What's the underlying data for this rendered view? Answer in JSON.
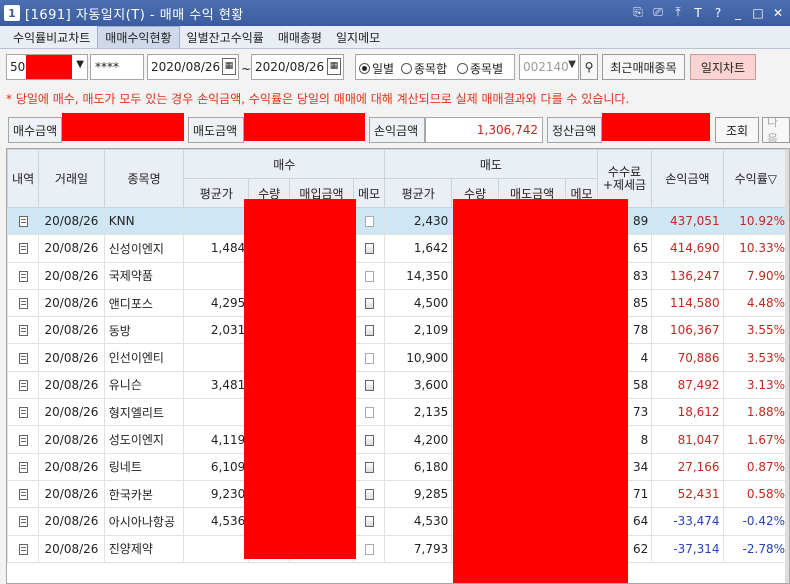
{
  "window": {
    "number": "1",
    "title": "[1691] 자동일지(T) - 매매 수익 현황",
    "controls": [
      "⎘",
      "⎚",
      "⤒",
      "T",
      "?",
      "_",
      "□",
      "✕"
    ]
  },
  "tabs": [
    {
      "label": "수익률비교차트",
      "active": false
    },
    {
      "label": "매매수익현황",
      "active": true
    },
    {
      "label": "일별잔고수익률",
      "active": false
    },
    {
      "label": "매매총평",
      "active": false
    },
    {
      "label": "일지메모",
      "active": false
    }
  ],
  "controls": {
    "account_prefix": "50",
    "password_mask": "****",
    "date_from": "2020/08/26",
    "date_sep": "~",
    "date_to": "2020/08/26",
    "radio_options": [
      {
        "label": "일별",
        "selected": true
      },
      {
        "label": "종목합",
        "selected": false
      },
      {
        "label": "종목별",
        "selected": false
      }
    ],
    "stock_code_placeholder": "002140",
    "recent_button": "최근매매종목",
    "chart_button": "일지차트"
  },
  "notice": "* 당일에 매수, 매도가 모두 있는 경우 손익금액, 수익률은 당일의 매매에 대해 계산되므로 실제 매매결과와 다를 수 있습니다.",
  "summary": {
    "buy_label": "매수금액",
    "sell_label": "매도금액",
    "profit_label": "손익금액",
    "profit_value": "1,306,742",
    "settle_label": "정산금액",
    "query_button": "조회",
    "next_button": "다음"
  },
  "table": {
    "headers": {
      "detail": "내역",
      "date": "거래일",
      "name": "종목명",
      "buy_group": "매수",
      "buy_avg": "평균가",
      "buy_qty": "수량",
      "buy_amount": "매입금액",
      "buy_memo": "메모",
      "sell_group": "매도",
      "sell_avg": "평균가",
      "sell_qty": "수량",
      "sell_amount": "매도금액",
      "sell_memo": "메모",
      "fee": "수수료\n+제세금",
      "profit": "손익금액",
      "rate": "수익률▽"
    },
    "rows": [
      {
        "date": "20/08/26",
        "name": "KNN",
        "buy_avg": "",
        "sell_avg": "2,430",
        "fee": "89",
        "profit": "437,051",
        "rate": "10.92%",
        "sign": "pos",
        "memo_filled": false
      },
      {
        "date": "20/08/26",
        "name": "신성이엔지",
        "buy_avg": "1,484",
        "sell_avg": "1,642",
        "fee": "65",
        "profit": "414,690",
        "rate": "10.33%",
        "sign": "pos",
        "memo_filled": true
      },
      {
        "date": "20/08/26",
        "name": "국제약품",
        "buy_avg": "",
        "sell_avg": "14,350",
        "fee": "83",
        "profit": "136,247",
        "rate": "7.90%",
        "sign": "pos",
        "memo_filled": false
      },
      {
        "date": "20/08/26",
        "name": "앤디포스",
        "buy_avg": "4,295",
        "sell_avg": "4,500",
        "fee": "85",
        "profit": "114,580",
        "rate": "4.48%",
        "sign": "pos",
        "memo_filled": true
      },
      {
        "date": "20/08/26",
        "name": "동방",
        "buy_avg": "2,031",
        "sell_avg": "2,109",
        "fee": "78",
        "profit": "106,367",
        "rate": "3.55%",
        "sign": "pos",
        "memo_filled": true
      },
      {
        "date": "20/08/26",
        "name": "인선이엔티",
        "buy_avg": "",
        "sell_avg": "10,900",
        "fee": "4",
        "profit": "70,886",
        "rate": "3.53%",
        "sign": "pos",
        "memo_filled": false
      },
      {
        "date": "20/08/26",
        "name": "유니슨",
        "buy_avg": "3,481",
        "sell_avg": "3,600",
        "fee": "58",
        "profit": "87,492",
        "rate": "3.13%",
        "sign": "pos",
        "memo_filled": true
      },
      {
        "date": "20/08/26",
        "name": "형지엘리트",
        "buy_avg": "",
        "sell_avg": "2,135",
        "fee": "73",
        "profit": "18,612",
        "rate": "1.88%",
        "sign": "pos",
        "memo_filled": false
      },
      {
        "date": "20/08/26",
        "name": "성도이엔지",
        "buy_avg": "4,119",
        "sell_avg": "4,200",
        "fee": "8",
        "profit": "81,047",
        "rate": "1.67%",
        "sign": "pos",
        "memo_filled": true
      },
      {
        "date": "20/08/26",
        "name": "링네트",
        "buy_avg": "6,109",
        "sell_avg": "6,180",
        "fee": "34",
        "profit": "27,166",
        "rate": "0.87%",
        "sign": "pos",
        "memo_filled": true
      },
      {
        "date": "20/08/26",
        "name": "한국카본",
        "buy_avg": "9,230",
        "sell_avg": "9,285",
        "fee": "71",
        "profit": "52,431",
        "rate": "0.58%",
        "sign": "pos",
        "memo_filled": true
      },
      {
        "date": "20/08/26",
        "name": "아시아나항공",
        "buy_avg": "4,536",
        "sell_avg": "4,530",
        "fee": "64",
        "profit": "-33,474",
        "rate": "-0.42%",
        "sign": "neg",
        "memo_filled": true
      },
      {
        "date": "20/08/26",
        "name": "진양제약",
        "buy_avg": "",
        "sell_avg": "7,793",
        "fee": "62",
        "profit": "-37,314",
        "rate": "-2.78%",
        "sign": "neg",
        "memo_filled": false
      }
    ]
  },
  "colors": {
    "title_bar": "#3b5d9f",
    "redaction": "#ff0000",
    "profit_positive": "#c4271c",
    "profit_negative": "#2a41b8",
    "notice": "#e8301a",
    "selected_row": "#cfe6f5"
  }
}
